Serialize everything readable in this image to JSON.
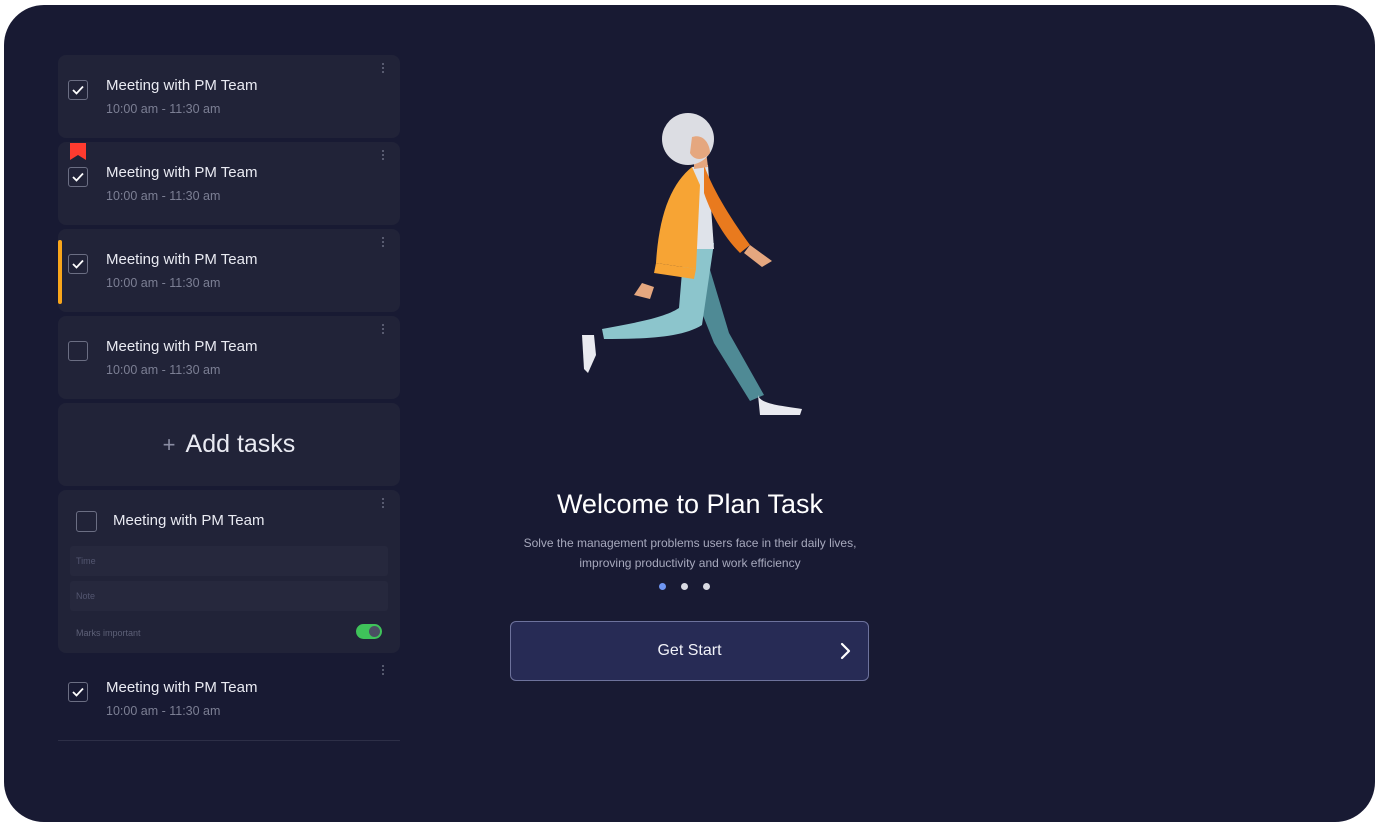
{
  "tasks": [
    {
      "title": "Meeting with PM Team",
      "time": "10:00 am - 11:30 am",
      "checked": true
    },
    {
      "title": "Meeting with PM Team",
      "time": "10:00 am - 11:30 am",
      "checked": true,
      "flagged": true
    },
    {
      "title": "Meeting with PM Team",
      "time": "10:00 am - 11:30 am",
      "checked": true,
      "highlighted": true
    },
    {
      "title": "Meeting with PM Team",
      "time": "10:00 am - 11:30 am",
      "checked": false
    }
  ],
  "add_tasks": {
    "plus": "+",
    "label": "Add tasks"
  },
  "new_task": {
    "title": "Meeting with PM Team",
    "time_placeholder": "Time",
    "note_placeholder": "Note",
    "marks_important_label": "Marks important",
    "marks_important": true
  },
  "last_task": {
    "title": "Meeting with PM Team",
    "time": "10:00 am - 11:30 am",
    "checked": true
  },
  "welcome": {
    "title": "Welcome to Plan Task",
    "subtitle_line1": "Solve the management problems users face in their daily lives,",
    "subtitle_line2": "improving productivity and work efficiency"
  },
  "pager": {
    "count": 3,
    "active": 1
  },
  "cta": {
    "label": "Get Start"
  },
  "colors": {
    "background": "#181a33",
    "card": "#212338",
    "accent_yellow": "#f9a61b",
    "flag_red": "#ff3b2f",
    "toggle_green": "#3fc35a",
    "pager_active": "#6f96f3",
    "cta_fill": "#272b55"
  }
}
